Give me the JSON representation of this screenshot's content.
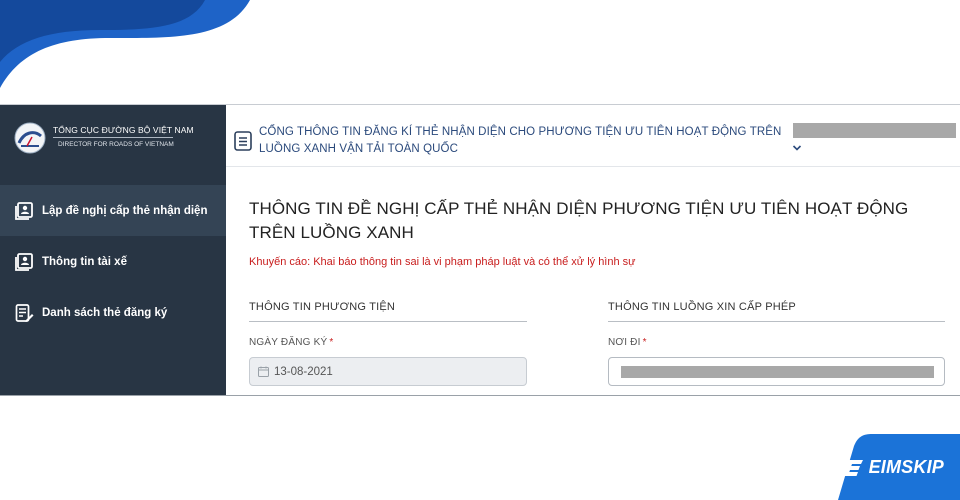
{
  "brand": {
    "title": "TỔNG CỤC ĐƯỜNG BỘ VIỆT NAM",
    "subtitle": "DIRECTOR FOR ROADS OF VIETNAM",
    "logo_icon": "agency-logo-icon"
  },
  "sidebar": {
    "items": [
      {
        "label": "Lập đề nghị cấp thẻ nhận diện",
        "icon": "id-card-icon",
        "active": true
      },
      {
        "label": "Thông tin tài xế",
        "icon": "driver-icon",
        "active": false
      },
      {
        "label": "Danh sách thẻ đăng ký",
        "icon": "list-edit-icon",
        "active": false
      }
    ]
  },
  "header": {
    "portal_title": "CỔNG THÔNG TIN ĐĂNG KÍ THẺ NHẬN DIỆN CHO PHƯƠNG TIỆN ƯU TIÊN HOẠT ĐỘNG TRÊN LUỒNG XANH VẬN TẢI TOÀN QUỐC",
    "menu_icon": "document-menu-icon",
    "user_dropdown_icon": "chevron-down-icon"
  },
  "form": {
    "title": "THÔNG TIN ĐỀ NGHỊ CẤP THẺ NHẬN DIỆN PHƯƠNG TIỆN ƯU TIÊN HOẠT ĐỘNG TRÊN LUỒNG XANH",
    "warning": "Khuyến cáo: Khai báo thông tin sai là vi phạm pháp luật và có thể xử lý hình sự",
    "sections": {
      "vehicle": "THÔNG TIN PHƯƠNG TIỆN",
      "route": "THÔNG TIN LUỒNG XIN CẤP PHÉP"
    },
    "fields": {
      "registration_date": {
        "label": "NGÀY ĐĂNG KÝ",
        "required": "*",
        "value": "13-08-2021",
        "icon": "calendar-icon"
      },
      "origin": {
        "label": "NƠI ĐI",
        "required": "*"
      }
    }
  },
  "watermark": {
    "brand": "EIMSKIP"
  },
  "colors": {
    "sidebar_bg": "#283544",
    "sidebar_active": "#344455",
    "accent_blue": "#1b73d8",
    "title_blue": "#2b4a7c",
    "warning_red": "#c81d1d"
  }
}
